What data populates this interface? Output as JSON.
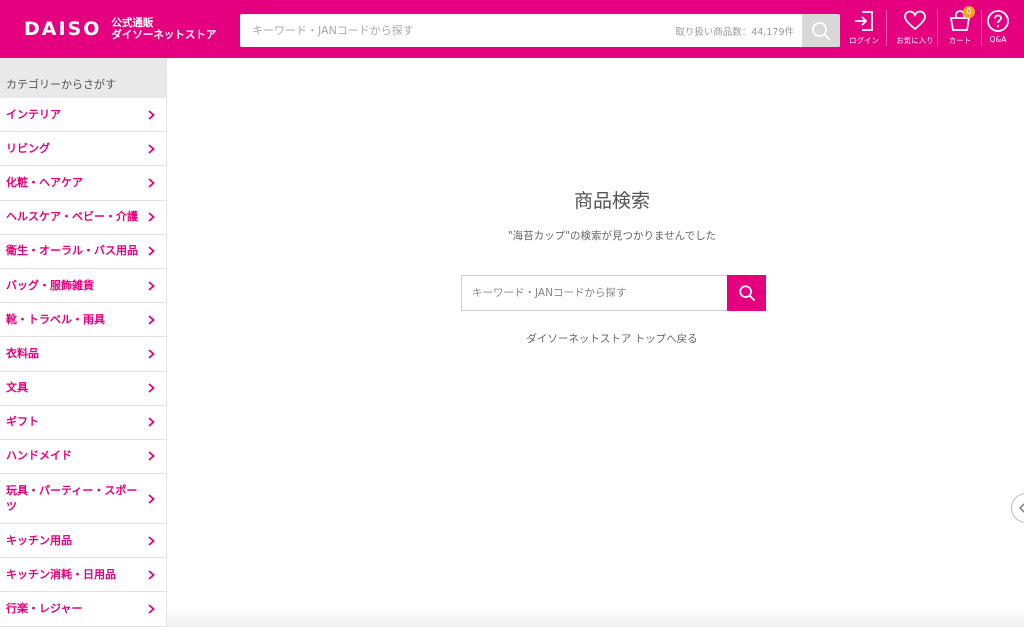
{
  "header": {
    "logo_word": "DAISO",
    "logo_sub_line1": "公式通販",
    "logo_sub_line2": "ダイソーネットストア",
    "search_placeholder": "キーワード・JANコードから探す",
    "search_count": "取り扱い商品数：44,179件",
    "icons": [
      {
        "name": "login-icon",
        "label": "ログイン"
      },
      {
        "name": "heart-icon",
        "label": "お気に入り"
      },
      {
        "name": "cart-icon",
        "label": "カート",
        "badge": "0"
      },
      {
        "name": "help-icon",
        "label": "Q&A"
      }
    ],
    "brand_color": "#e5007f"
  },
  "sidebar": {
    "heading": "カテゴリーからさがす",
    "items": [
      {
        "label": "インテリア"
      },
      {
        "label": "リビング"
      },
      {
        "label": "化粧・ヘアケア"
      },
      {
        "label": "ヘルスケア・ベビー・介護"
      },
      {
        "label": "衛生・オーラル・バス用品"
      },
      {
        "label": "バッグ・服飾雑貨"
      },
      {
        "label": "靴・トラベル・雨具"
      },
      {
        "label": "衣料品"
      },
      {
        "label": "文具"
      },
      {
        "label": "ギフト"
      },
      {
        "label": "ハンドメイド"
      },
      {
        "label": "玩具・パーティー・スポーツ"
      },
      {
        "label": "キッチン用品"
      },
      {
        "label": "キッチン消耗・日用品"
      },
      {
        "label": "行楽・レジャー"
      }
    ]
  },
  "main": {
    "title": "商品検索",
    "message": "\"海苔カップ\"の検索が見つかりませんでした",
    "search_placeholder": "キーワード・JANコードから探す",
    "back_link": "ダイソーネットストア トップへ戻る"
  }
}
